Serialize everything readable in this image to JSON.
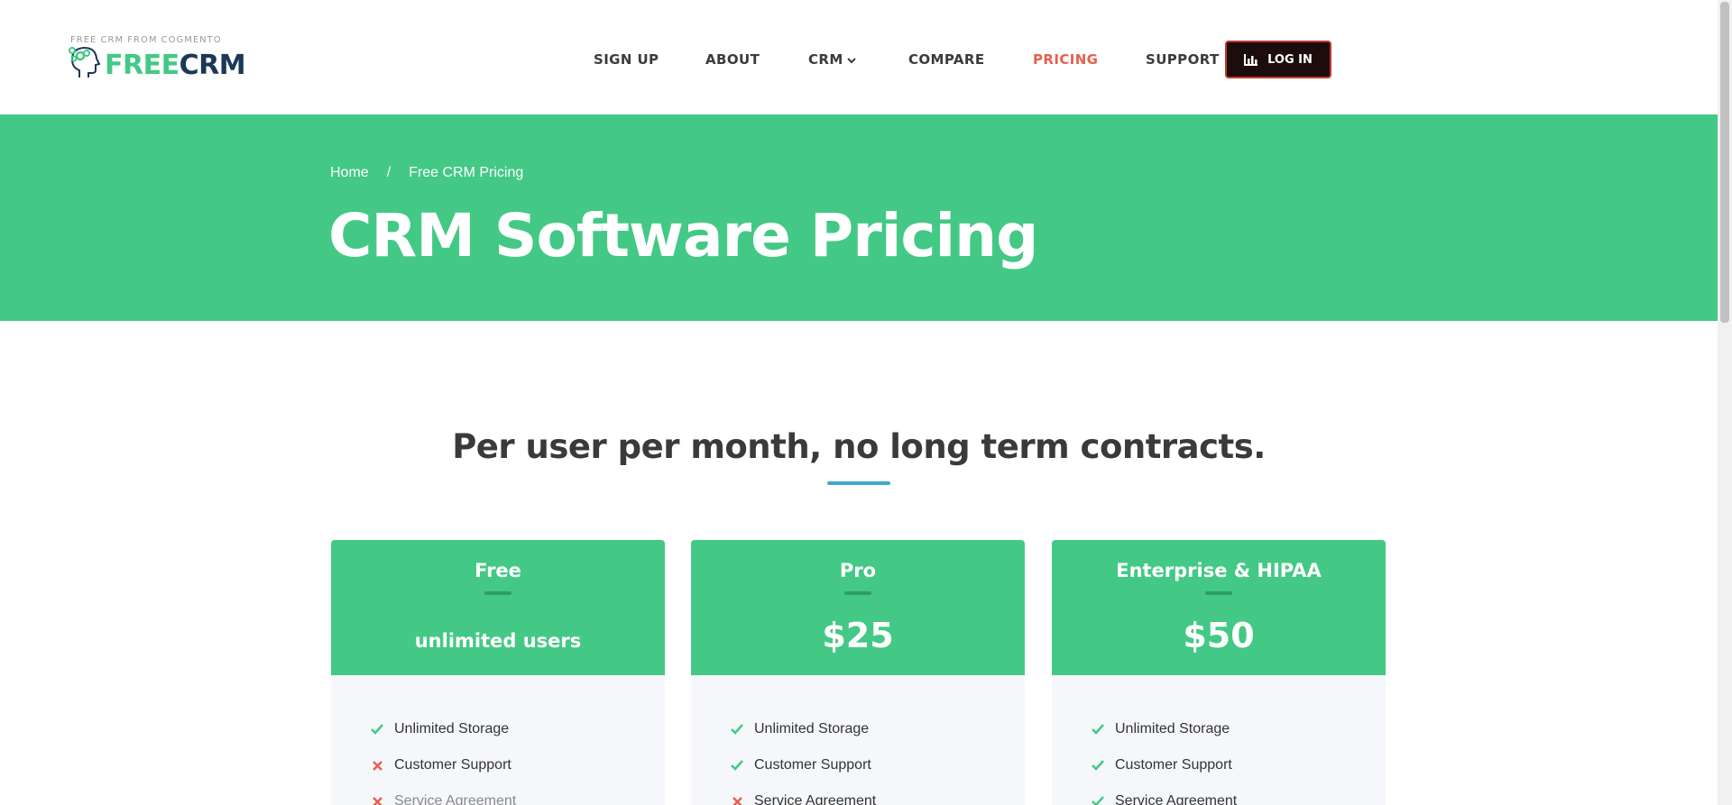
{
  "logo": {
    "tagline": "FREE CRM FROM COGMENTO",
    "word_free": "FREE",
    "word_crm": "CRM"
  },
  "nav": {
    "items": [
      {
        "label": "SIGN UP"
      },
      {
        "label": "ABOUT"
      },
      {
        "label": "CRM",
        "has_dropdown": true
      },
      {
        "label": "COMPARE"
      },
      {
        "label": "PRICING",
        "active": true
      },
      {
        "label": "SUPPORT"
      }
    ],
    "login_label": "LOG IN"
  },
  "hero": {
    "breadcrumb": [
      "Home",
      "Free CRM Pricing"
    ],
    "breadcrumb_separator": "/",
    "title": "CRM Software Pricing"
  },
  "section": {
    "title": "Per user per month, no long term contracts."
  },
  "plans": [
    {
      "name": "Free",
      "price": "unlimited users",
      "features": [
        {
          "label": "Unlimited Storage",
          "included": true
        },
        {
          "label": "Customer Support",
          "included": false
        },
        {
          "label": "Service Agreement",
          "included": false
        }
      ]
    },
    {
      "name": "Pro",
      "price": "$25",
      "features": [
        {
          "label": "Unlimited Storage",
          "included": true
        },
        {
          "label": "Customer Support",
          "included": true
        },
        {
          "label": "Service Agreement",
          "included": false
        }
      ]
    },
    {
      "name": "Enterprise & HIPAA",
      "price": "$50",
      "features": [
        {
          "label": "Unlimited Storage",
          "included": true
        },
        {
          "label": "Customer Support",
          "included": true
        },
        {
          "label": "Service Agreement",
          "included": true
        }
      ]
    }
  ],
  "colors": {
    "brand_green": "#43c985",
    "brand_navy": "#1b3857",
    "active_nav": "#e5604f",
    "check": "#43c985",
    "cross": "#e5604f",
    "accent_underline": "#3fa7cb"
  },
  "icons": {
    "included": "check-icon",
    "excluded": "cross-icon",
    "login": "bar-chart-icon",
    "logo": "head-gears-icon",
    "dropdown": "chevron-down-icon"
  }
}
